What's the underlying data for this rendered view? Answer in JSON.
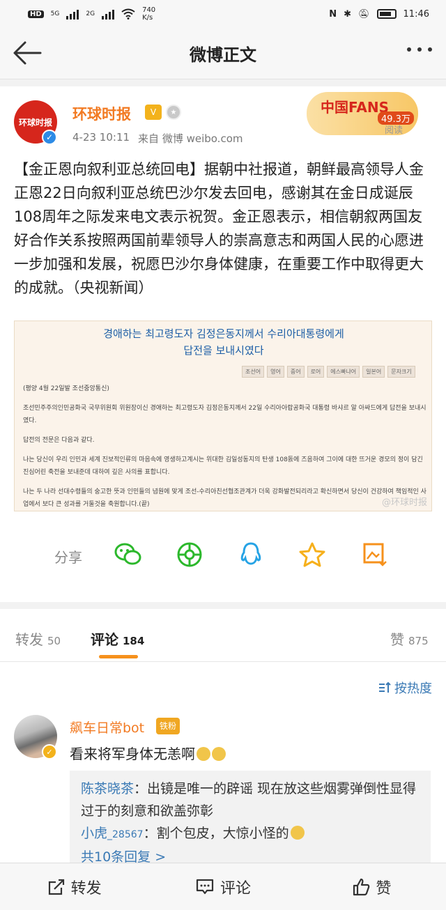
{
  "status_bar": {
    "left_label": "HD",
    "net1": "5G",
    "net2": "2G",
    "speed": "740\nK/s",
    "time": "11:46"
  },
  "nav": {
    "title": "微博正文",
    "back_icon": "arrow-left-icon",
    "more_icon": "more-dots-icon"
  },
  "post": {
    "avatar_text": "环球时报",
    "username": "环球时报",
    "vip_label": "V",
    "meta_time": "4-23 10:11",
    "meta_source": "来自 微博 weibo.com",
    "fans_badge": "中国FANS",
    "fans_count": "49.3万",
    "fans_read": "阅读",
    "text": "【金正恩向叙利亚总统回电】据朝中社报道，朝鲜最高领导人金正恩22日向叙利亚总统巴沙尔发去回电，感谢其在金日成诞辰108周年之际发来电文表示祝贺。金正恩表示，相信朝叙两国友好合作关系按照两国前辈领导人的崇高意志和两国人民的心愿进一步加强和发展，祝愿巴沙尔身体健康，在重要工作中取得更大的成就。（央视新闻）",
    "image": {
      "headline_1": "경애하는 최고령도자 김정은동지께서 수리아대통령에게",
      "headline_2": "답전을 보내시였다",
      "langs": [
        "조선어",
        "영어",
        "중어",
        "로어",
        "에스빠냐어",
        "일본어",
        "문자크기"
      ],
      "dateline": "(평양 4월 22일발 조선중앙통신)",
      "para1": "조선민주주의인민공화국 국무위원회 위원장이신 경애하는 최고령도자 김정은동지께서 22일 수리아아랍공화국 대통령 바샤르 알 아싸드에게 답전을 보내시였다.",
      "para2": "답전의 전문은 다음과 같다.",
      "para3": "나는 당신이 우리 인민과 세계 진보적인류의 마음속에 영생하고계시는 위대한 김일성동지의 탄생 108돐에 즈음하여 그이에 대한 뜨거운 경모의 정이 담긴 진심어린 축전을 보내준데 대하여 깊은 사의를 표합니다.",
      "para4": "나는 두 나라 선대수령들의 숭고한 뜻과 인민들의 념원에 맞게 조선-수리아친선협조관계가 더욱 강화발전되리라고 확신하면서 당신이 건강하여 책임적인 사업에서 보다 큰 성과를 거둘것을 축원합니다.(끝)",
      "watermark": "@环球时报"
    },
    "share_label": "分享"
  },
  "tabs": {
    "repost_label": "转发",
    "repost_count": "50",
    "comment_label": "评论",
    "comment_count": "184",
    "like_label": "赞",
    "like_count": "875"
  },
  "comments": {
    "sort_label": "按热度",
    "items": [
      {
        "name": "飙车日常bot",
        "badge": "铁粉",
        "text": "看来将军身体无恙啊",
        "replies": [
          {
            "name": "陈茶晓茶",
            "text": "：出镜是唯一的辟谣 现在放这些烟雾弹倒性显得过于的刻意和欲盖弥彰"
          },
          {
            "name": "小虎",
            "uid": "_28567",
            "text": "：割个包皮，大惊小怪的"
          }
        ],
        "more": "共10条回复 >"
      }
    ]
  },
  "bottom_bar": {
    "repost": "转发",
    "comment": "评论",
    "like": "赞"
  },
  "colors": {
    "accent_orange": "#f27a22",
    "link_blue": "#3b7ab5",
    "tab_underline": "#f6911c"
  }
}
